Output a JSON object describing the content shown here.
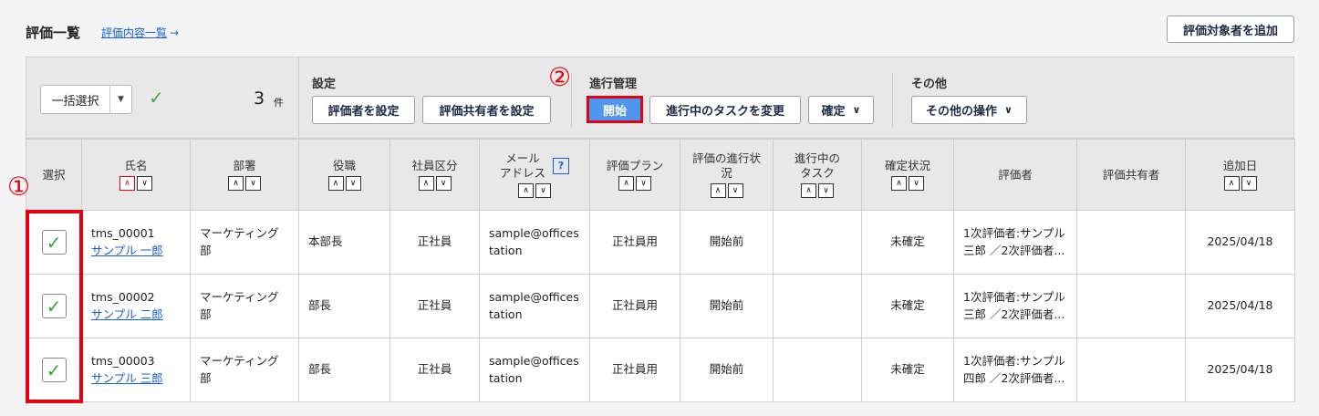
{
  "header": {
    "title": "評価一覧",
    "content_link": "評価内容一覧",
    "link_arrow": "→",
    "add_button": "評価対象者を追加"
  },
  "toolbar": {
    "bulk_select": "一括選択",
    "caret": "▼",
    "check": "✓",
    "count": "3",
    "count_unit": "件",
    "settings_label": "設定",
    "set_evaluator": "評価者を設定",
    "set_sharer": "評価共有者を設定",
    "progress_label": "進行管理",
    "start": "開始",
    "change_task": "進行中のタスクを変更",
    "confirm": "確定",
    "confirm_caret": "∨",
    "other_label": "その他",
    "other_ops": "その他の操作",
    "other_caret": "∨"
  },
  "annotations": {
    "one": "①",
    "two": "②"
  },
  "columns": {
    "select": "選択",
    "name": "氏名",
    "dept": "部署",
    "position": "役職",
    "emp_type": "社員区分",
    "email_1": "メール",
    "email_2": "アドレス",
    "help": "?",
    "plan": "評価プラン",
    "progress_1": "評価の進行状",
    "progress_2": "況",
    "task_1": "進行中の",
    "task_2": "タスク",
    "confirm": "確定状況",
    "evaluator": "評価者",
    "sharer": "評価共有者",
    "added": "追加日",
    "sort_up": "∧",
    "sort_down": "∨"
  },
  "rows": [
    {
      "check": "✓",
      "id": "tms_00001",
      "name": "サンプル 一郎",
      "dept": "マーケティング部",
      "position": "本部長",
      "emp_type": "正社員",
      "email": "sample@officestation",
      "plan": "正社員用",
      "progress": "開始前",
      "task": "",
      "confirm": "未確定",
      "evaluator": "1次評価者:サンプル三郎 ／2次評価者...",
      "sharer": "",
      "added": "2025/04/18"
    },
    {
      "check": "✓",
      "id": "tms_00002",
      "name": "サンプル 二郎",
      "dept": "マーケティング部",
      "position": "部長",
      "emp_type": "正社員",
      "email": "sample@officestation",
      "plan": "正社員用",
      "progress": "開始前",
      "task": "",
      "confirm": "未確定",
      "evaluator": "1次評価者:サンプル三郎 ／2次評価者...",
      "sharer": "",
      "added": "2025/04/18"
    },
    {
      "check": "✓",
      "id": "tms_00003",
      "name": "サンプル 三郎",
      "dept": "マーケティング部",
      "position": "部長",
      "emp_type": "正社員",
      "email": "sample@officestation",
      "plan": "正社員用",
      "progress": "開始前",
      "task": "",
      "confirm": "未確定",
      "evaluator": "1次評価者:サンプル四郎 ／2次評価者...",
      "sharer": "",
      "added": "2025/04/18"
    }
  ]
}
